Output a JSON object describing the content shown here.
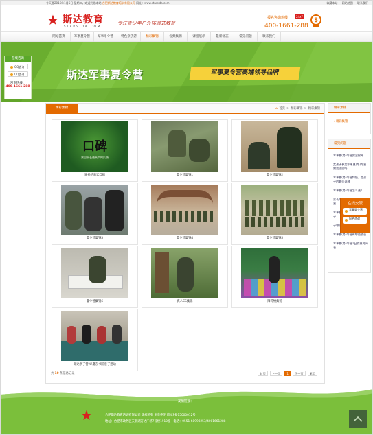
{
  "topbar": {
    "welcome": "今天是2016年1月5日 星期二，欢迎光临本站",
    "company_highlight": "合肥斯达教育培训有限公司",
    "site_label": "网址：www.starsida.com",
    "links": [
      "收藏本站",
      "网站地图",
      "联系我们"
    ]
  },
  "header": {
    "logo_cn": "斯达教育",
    "logo_en": "STARSIDA.COM",
    "slogan": "专注青少年户外体验式教育",
    "hotline_label": "报名咨询热线",
    "hotline_badge": "24x7",
    "hotline_number": "400-1661-288"
  },
  "nav": {
    "items": [
      "网站首页",
      "军事夏令营",
      "军事冬令营",
      "特色亲子游",
      "精彩集锦",
      "视频集锦",
      "课程展示",
      "最新动态",
      "常见问题",
      "联系我们"
    ],
    "active_index": 4
  },
  "banner": {
    "title": "斯达军事夏令营",
    "subtitle": "军事夏令营高端领导品牌"
  },
  "float_left": {
    "title": "在线咨询",
    "qq": [
      "QQ咨询",
      "QQ咨询"
    ],
    "hotline_label": "咨询热线：",
    "hotline_number": "400-1661-288"
  },
  "main": {
    "tab": "精彩集锦",
    "breadcrumb": [
      "首页",
      ">",
      "精彩集锦",
      ">",
      "精彩集锦"
    ],
    "cards": [
      {
        "caption": "家长的真实口碑"
      },
      {
        "caption": "夏令营集锦1"
      },
      {
        "caption": "夏令营集锦2"
      },
      {
        "caption": "夏令营集锦3"
      },
      {
        "caption": "夏令营集锦4"
      },
      {
        "caption": "夏令营集锦5"
      },
      {
        "caption": "夏令营集锦6"
      },
      {
        "caption": "真人CS集锦"
      },
      {
        "caption": "障碍物集锦"
      },
      {
        "caption": "斯达亲子营-纵夏东书院亲子活动"
      }
    ],
    "card1_text": "口碑",
    "card1_subtext": "来自家长最真实的反馈",
    "pager_prefix": "共",
    "pager_count": "10",
    "pager_suffix": "条信息记录",
    "pager_buttons": [
      "首页",
      "上一页",
      "1",
      "下一页",
      "尾页"
    ],
    "pager_current_index": 2
  },
  "sidebar": {
    "box1_title": "精彩集锦",
    "box1_item": "精彩集锦",
    "box2_title": "常见问题",
    "box2_items": [
      "军事夏(冬)令营安全保障",
      "女孩子参加军事夏(冬)令营需要适应吗",
      "军事夏(冬)令营特色，是孩子的最佳选择",
      "军事夏(冬)令营怎么选？",
      "家长如何选择军事夏(冬)令营",
      "军事夏令营适合什么样的孩子",
      "子哪家怎么办",
      "军事夏(冬)令营有哪些收获",
      "军事夏(冬)令营1日作息时间表"
    ]
  },
  "float_chat": {
    "title": "在线交流",
    "buttons": [
      "军事夏令营",
      "报名咨询"
    ]
  },
  "footer": {
    "friend_label": "友情链接：",
    "copyright": "合肥斯达教育培训有限公司 版权所有 免责申明 皖ICP备15000012号",
    "address": "地址：合肥市政务区天鹅湖万达广场7号楼1910室 · 电话：0551-68998253/4001661288"
  },
  "colors": {
    "brand_red": "#d8211f",
    "accent_orange": "#e36a00",
    "banner_green": "#7bbf3b"
  }
}
